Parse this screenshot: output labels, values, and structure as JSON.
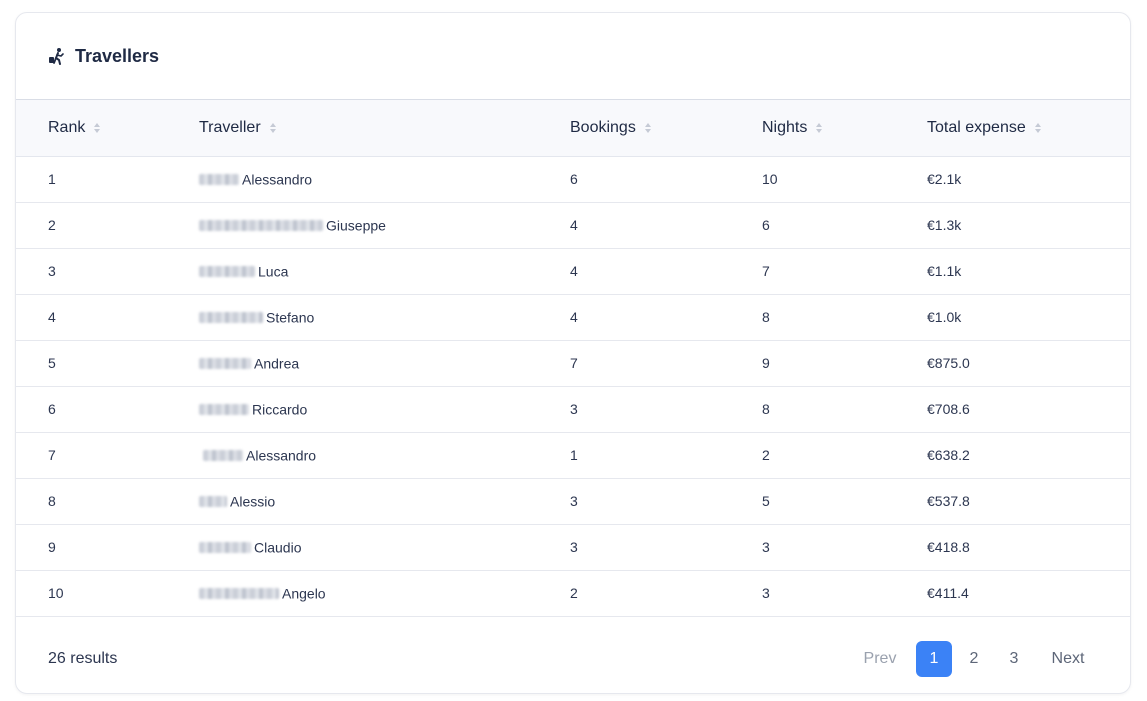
{
  "header": {
    "title": "Travellers",
    "icon": "traveller-luggage-icon"
  },
  "table": {
    "columns": [
      "Rank",
      "Traveller",
      "Bookings",
      "Nights",
      "Total expense"
    ],
    "rows": [
      {
        "rank": "1",
        "name": "Alessandro",
        "bookings": "6",
        "nights": "10",
        "expense": "€2.1k"
      },
      {
        "rank": "2",
        "name": "Giuseppe",
        "bookings": "4",
        "nights": "6",
        "expense": "€1.3k"
      },
      {
        "rank": "3",
        "name": "Luca",
        "bookings": "4",
        "nights": "7",
        "expense": "€1.1k"
      },
      {
        "rank": "4",
        "name": "Stefano",
        "bookings": "4",
        "nights": "8",
        "expense": "€1.0k"
      },
      {
        "rank": "5",
        "name": "Andrea",
        "bookings": "7",
        "nights": "9",
        "expense": "€875.0"
      },
      {
        "rank": "6",
        "name": "Riccardo",
        "bookings": "3",
        "nights": "8",
        "expense": "€708.6"
      },
      {
        "rank": "7",
        "name": "Alessandro",
        "bookings": "1",
        "nights": "2",
        "expense": "€638.2"
      },
      {
        "rank": "8",
        "name": "Alessio",
        "bookings": "3",
        "nights": "5",
        "expense": "€537.8"
      },
      {
        "rank": "9",
        "name": "Claudio",
        "bookings": "3",
        "nights": "3",
        "expense": "€418.8"
      },
      {
        "rank": "10",
        "name": "Angelo",
        "bookings": "2",
        "nights": "3",
        "expense": "€411.4"
      }
    ]
  },
  "footer": {
    "results": "26 results",
    "prev": "Prev",
    "pages": [
      "1",
      "2",
      "3"
    ],
    "current_page": "1",
    "next": "Next"
  },
  "colors": {
    "accent": "#3b82f6",
    "header_bg": "#f8f9fc",
    "text": "#1f2a44"
  }
}
